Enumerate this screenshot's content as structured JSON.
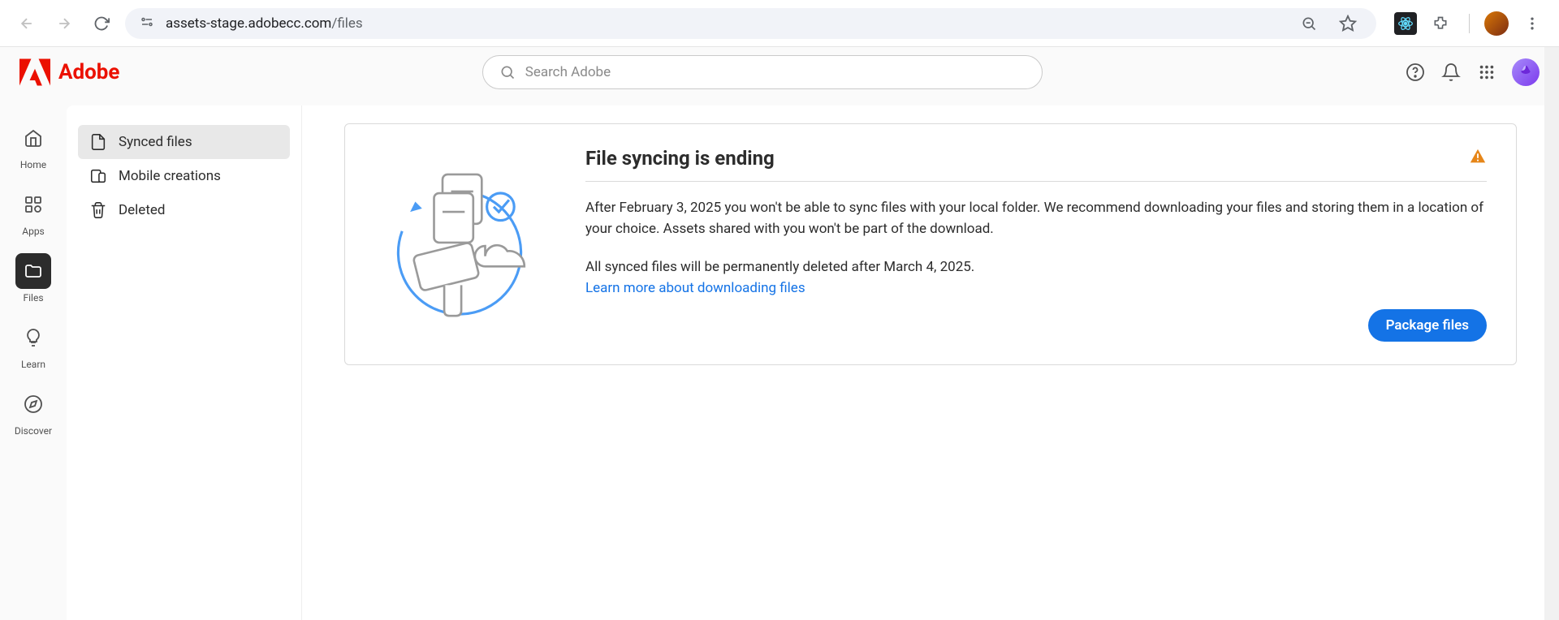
{
  "browser": {
    "url_host": "assets-stage.adobecc.com",
    "url_path": "/files"
  },
  "header": {
    "brand": "Adobe",
    "search_placeholder": "Search Adobe"
  },
  "rail": [
    {
      "id": "home",
      "label": "Home",
      "active": false
    },
    {
      "id": "apps",
      "label": "Apps",
      "active": false
    },
    {
      "id": "files",
      "label": "Files",
      "active": true
    },
    {
      "id": "learn",
      "label": "Learn",
      "active": false
    },
    {
      "id": "discover",
      "label": "Discover",
      "active": false
    }
  ],
  "sidebar": [
    {
      "id": "synced",
      "label": "Synced files",
      "active": true
    },
    {
      "id": "mobile",
      "label": "Mobile creations",
      "active": false
    },
    {
      "id": "deleted",
      "label": "Deleted",
      "active": false
    }
  ],
  "notice": {
    "title": "File syncing is ending",
    "para1": "After February 3, 2025 you won't be able to sync files with your local folder. We recommend downloading your files and storing them in a location of your choice. Assets shared with you won't be part of the download.",
    "para2": "All synced files will be permanently deleted after March 4, 2025.",
    "learn_link": "Learn more about downloading files",
    "cta": "Package files"
  }
}
